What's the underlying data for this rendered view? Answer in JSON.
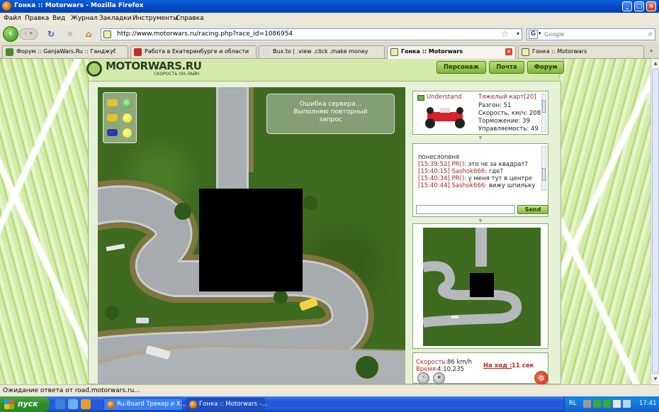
{
  "window": {
    "title": "Гонка :: Motorwars - Mozilla Firefox"
  },
  "menu": [
    "Файл",
    "Правка",
    "Вид",
    "Журнал",
    "Закладки",
    "Инструменты",
    "Справка"
  ],
  "nav": {
    "url": "http://www.motorwars.ru/racing.php?race_id=1086954",
    "search_placeholder": "Google"
  },
  "tabs": [
    {
      "label": "Форум :: GanjaWars.Ru :: Ганджубас...",
      "color": "#4b8a2a"
    },
    {
      "label": "Работа в Екатеринбурге и области",
      "color": "#c62a2a"
    },
    {
      "label": "Bux.to | .view .click .make money",
      "color": "#dddddd"
    },
    {
      "label": "Гонка :: Motorwars",
      "color": "#e8f0a0"
    },
    {
      "label": "Гонка :: Motorwars",
      "color": "#e8f0a0"
    }
  ],
  "site": {
    "logo": "MOTORWARS.RU",
    "logo_sub": "СКОРОСТЬ ОН-ЛАЙН",
    "buttons": [
      "Персонаж",
      "Почта",
      "Форум"
    ]
  },
  "game": {
    "error": [
      "Ошибка сервера...",
      "Выполняю повторный",
      "запрос"
    ]
  },
  "racer": {
    "name": "Understand",
    "kart": "Тяжелый карт[20]",
    "stats": [
      "Разгон: 51",
      "Скорость, км/ч: 208",
      "Торможение: 39",
      "Управляемость: 49"
    ]
  },
  "chat": {
    "lines": [
      {
        "ts": "",
        "text": "понеслоnеня"
      },
      {
        "ts": "[15:39:52] PR():",
        "text": " это че за квадрат?"
      },
      {
        "ts": "[15:40:15] Sashok666:",
        "text": " где?"
      },
      {
        "ts": "[15:40:34] PR():",
        "text": " у меня тут в центре"
      },
      {
        "ts": "[15:40:44] Sashok666:",
        "text": " вижу шпильку"
      }
    ],
    "input_value": "",
    "send": "Send"
  },
  "speed": {
    "speed_label": "Скорость:",
    "speed_value": "86 km/h",
    "time_label": "Время:",
    "time_value": "4:10.235",
    "turn_label": "На ход :",
    "turn_value": "11 сек"
  },
  "status": "Ожидание ответа от road.motorwars.ru...",
  "taskbar": {
    "start": "пуск",
    "items": [
      "Ru-Board Трекер и Х...",
      "Гонка :: Motorwars -..."
    ],
    "lang": "RL",
    "clock": "17:41"
  }
}
